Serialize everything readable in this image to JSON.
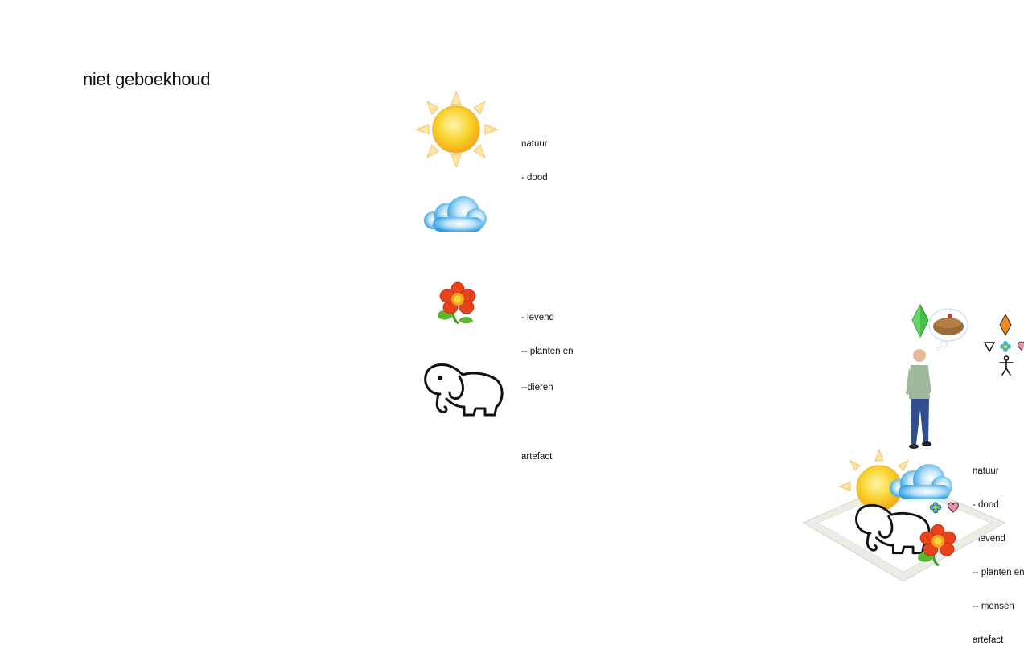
{
  "title": "niet geboekhoud",
  "legend": {
    "sun_label": [
      "natuur",
      "- dood"
    ],
    "flower_label": [
      "- levend",
      "-- planten en"
    ],
    "elephant_label": "--dieren",
    "artefact_label": "artefact"
  },
  "scene": {
    "labels": [
      "natuur",
      "- dood",
      "- levend",
      "-- planten en",
      "-- mensen",
      "artefact"
    ]
  },
  "colors": {
    "sun": "#f7c51e",
    "cloud": "#3aa6e6",
    "flower": "#e8431a",
    "leaf": "#4aa52a",
    "diamond_green": "#3fbf3f",
    "diamond_orange": "#f08a1c"
  },
  "icons": [
    "sun-icon",
    "cloud-icon",
    "flower-icon",
    "elephant-icon",
    "person-icon",
    "thought-bubble-icon",
    "plumbob-icon"
  ]
}
